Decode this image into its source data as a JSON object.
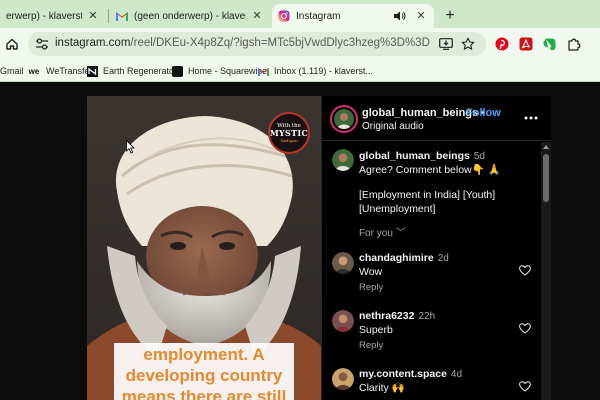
{
  "browser": {
    "tabs": [
      {
        "title": "erwerp) - klaverst@gmail.co",
        "icon": "gmail-icon",
        "active": false
      },
      {
        "title": "(geen onderwerp) - klaverst@gmail.co",
        "icon": "gmail-icon",
        "active": false
      },
      {
        "title": "Instagram",
        "icon": "instagram-icon",
        "active": true
      }
    ],
    "url_main": "instagram.com",
    "url_rest": "/reel/DKEu-X4p8Zq/?igsh=MTc5bjVwdDlyc3hzeg%3D%3D",
    "bookmarks": [
      {
        "label": "Gmail",
        "icon": "gmail-icon"
      },
      {
        "label": "WeTransfer",
        "icon": "wetransfer-icon"
      },
      {
        "label": "Earth Regenerators",
        "icon": "earth-regenerators-icon"
      },
      {
        "label": "Home - Squarewise",
        "icon": "squarewise-icon"
      },
      {
        "label": "Inbox (1.119) - klaverst...",
        "icon": "gmail-icon"
      }
    ]
  },
  "reel": {
    "badge_line1": "With the",
    "badge_line2": "MYSTIC",
    "badge_line3": "Sadhguru",
    "caption": "employment. A developing country means there are still"
  },
  "post": {
    "username": "global_human_beings",
    "follow_label": "Follow",
    "audio_label": "Original audio",
    "caption_user": "global_human_beings",
    "caption_time": "5d",
    "caption_line1": "Agree? Comment below👇 🙏",
    "caption_line2": "[Employment in India] [Youth]",
    "caption_line3": "[Unemployment]",
    "for_you_label": "For you",
    "comments": [
      {
        "user": "chandaghimire",
        "time": "2d",
        "text": "Wow",
        "reply_label": "Reply"
      },
      {
        "user": "nethra6232",
        "time": "22h",
        "text": "Superb",
        "reply_label": "Reply"
      },
      {
        "user": "my.content.space",
        "time": "4d",
        "text": "Clarity 🙌",
        "reply_label": ""
      }
    ]
  },
  "colors": {
    "tab_bar": "#cfe8c9",
    "toolbar": "#f1f8ee",
    "follow_blue": "#4aa3ff",
    "caption_orange": "#e58a2e"
  }
}
